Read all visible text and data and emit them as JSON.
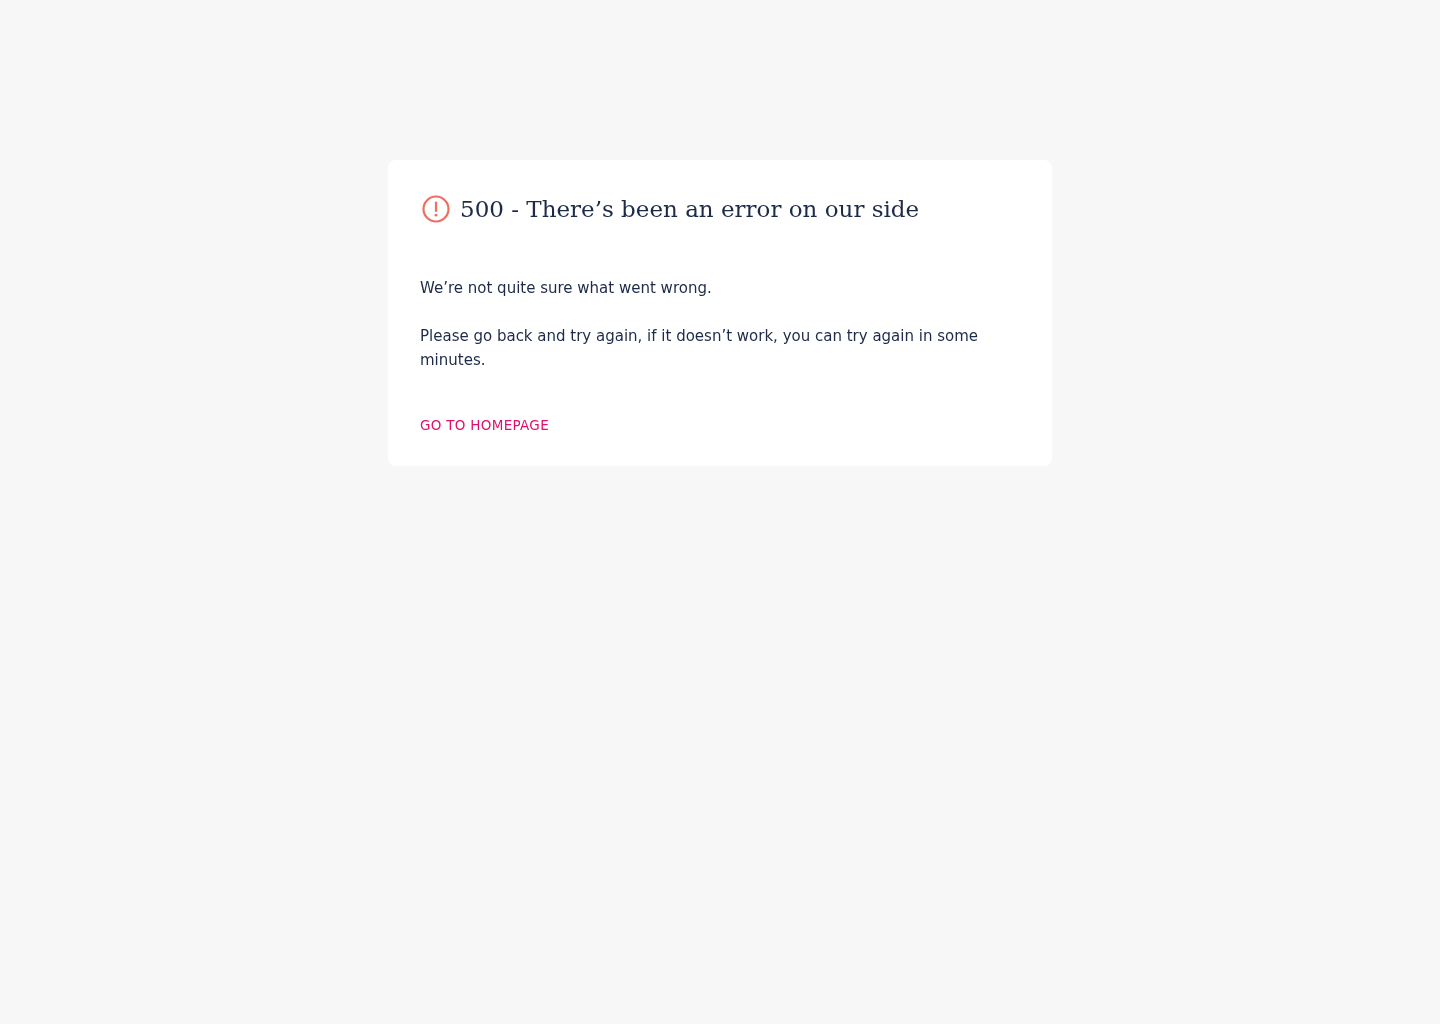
{
  "card": {
    "title": "500 - There’s been an error on our side",
    "paragraphs": [
      "We’re not quite sure what went wrong.",
      "Please go back and try again, if it doesn’t work, you can try again in some minutes."
    ],
    "link": "GO TO HOMEPAGE"
  }
}
